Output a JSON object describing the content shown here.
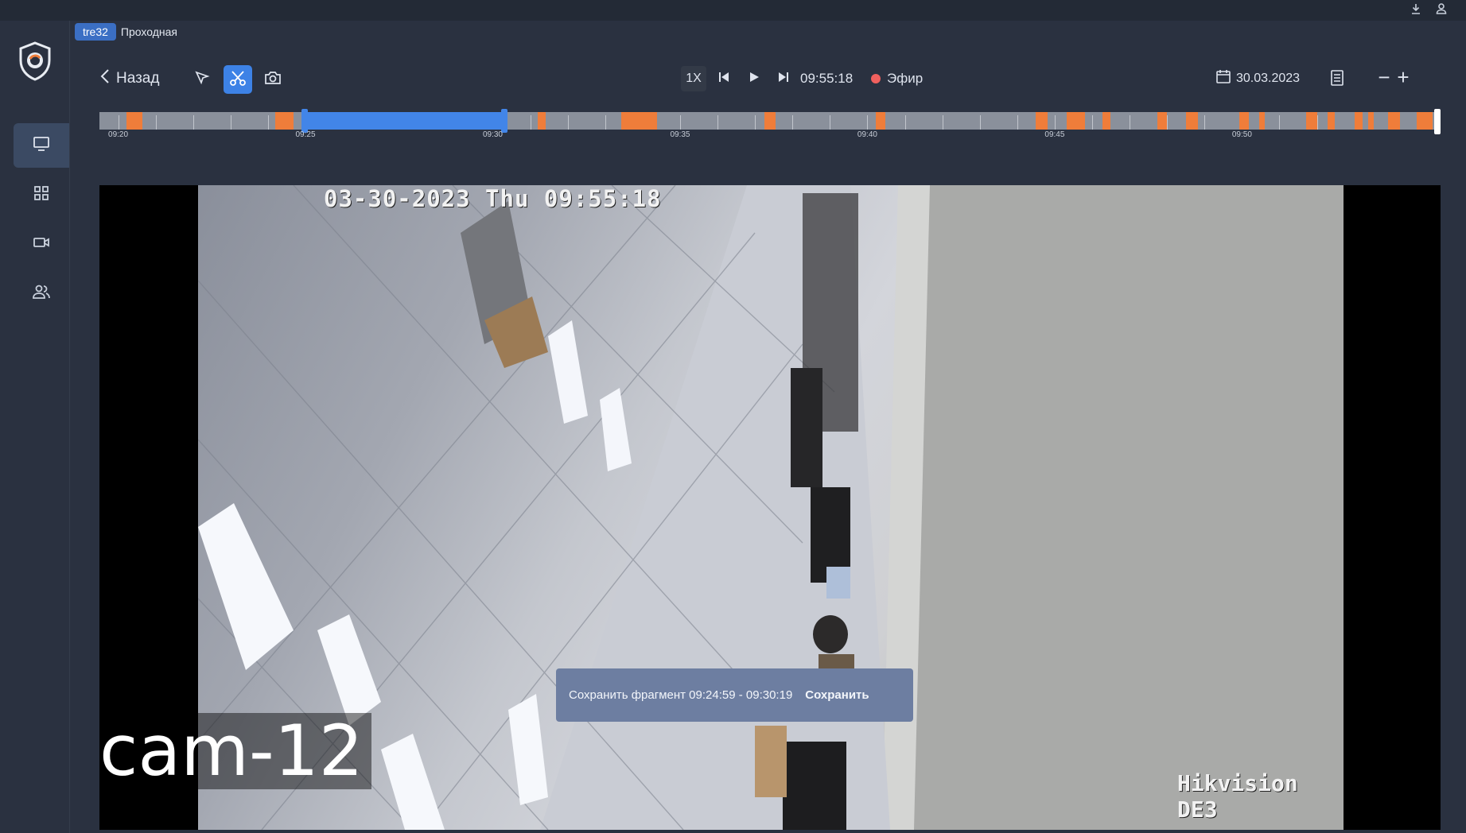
{
  "colors": {
    "background": "#2a3140",
    "accent": "#3d82e6",
    "event": "#ef7d3a",
    "live": "#f0605e",
    "toast": "#6d7ea1"
  },
  "topbar": {
    "icons": [
      "download-icon",
      "user-icon"
    ]
  },
  "sidebar": {
    "logo": "shield-logo",
    "items": [
      {
        "icon": "monitor-icon",
        "active": true
      },
      {
        "icon": "grid-icon",
        "active": false
      },
      {
        "icon": "video-camera-icon",
        "active": false
      },
      {
        "icon": "users-icon",
        "active": false
      }
    ]
  },
  "breadcrumb": {
    "chip": "tre32",
    "title": "Проходная"
  },
  "toolbar": {
    "back_label": "Назад",
    "tools": [
      "cursor-icon",
      "scissors-icon",
      "camera-icon"
    ],
    "active_tool": "scissors-icon",
    "speed": "1X",
    "current_time": "09:55:18",
    "live_label": "Эфир",
    "date": "30.03.2023"
  },
  "timeline": {
    "start": "09:19:30",
    "end": "09:55:18",
    "ticks": [
      "09:20",
      "09:25",
      "09:30",
      "09:35",
      "09:40",
      "09:45",
      "09:50"
    ],
    "selection": {
      "from": "09:24:59",
      "to": "09:30:19"
    },
    "playhead": "09:55:18"
  },
  "video": {
    "osd_time": "03-30-2023 Thu 09:55:18",
    "osd_brand": "Hikvision DE3",
    "camera_label": "cam-12"
  },
  "toast": {
    "text": "Сохранить фрагмент 09:24:59 - 09:30:19",
    "action": "Сохранить"
  }
}
